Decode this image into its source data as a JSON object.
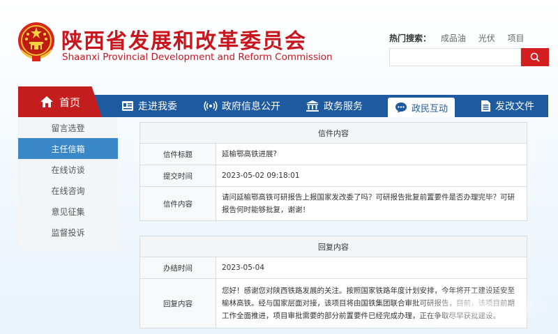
{
  "header": {
    "title_cn": "陕西省发展和改革委员会",
    "title_en": "Shaanxi Provincial Development and Reform Commission",
    "hot_search_label": "热门搜索：",
    "hot_search_items": [
      "成品油",
      "光伏",
      "项目"
    ],
    "search_placeholder": ""
  },
  "nav": {
    "home": "首页",
    "items": [
      "走进我委",
      "政府信息公开",
      "政务服务",
      "政民互动",
      "发改文件"
    ],
    "active": "政民互动"
  },
  "sidebar": {
    "items": [
      "留言选登",
      "主任信箱",
      "在线访谈",
      "在线咨询",
      "意见征集",
      "监督投诉"
    ],
    "active": "主任信箱"
  },
  "letter": {
    "heading": "信件内容",
    "rows": [
      {
        "label": "信件标题",
        "value": "延榆鄂高铁进展?"
      },
      {
        "label": "提交时间",
        "value": "2023-05-02 09:18:01"
      },
      {
        "label": "信件内容",
        "value": "请问延榆鄂高铁可研报告上报国家发改委了吗？可研报告批复前置要件是否办理完毕？可研报告何时能够批复，谢谢！"
      }
    ]
  },
  "reply": {
    "heading": "回复内容",
    "rows": [
      {
        "label": "办结时间",
        "value": "2023-05-04"
      },
      {
        "label": "回复内容",
        "value": "您好！感谢您对陕西铁路发展的关注。按照国家铁路年度计划安排，今年将开工建设延安至榆林高铁。经与国家层面对接，该项目将由国铁集团联合审批可研报告，目前，该项目前期工作全面推进，项目审批需要的部分前置要件已经完成办理，正在争取尽早获批建设。"
      }
    ]
  },
  "colors": {
    "brand_red": "#c8161e",
    "nav_blue": "#1d5aa0",
    "sidebar_active": "#3a88c8"
  }
}
